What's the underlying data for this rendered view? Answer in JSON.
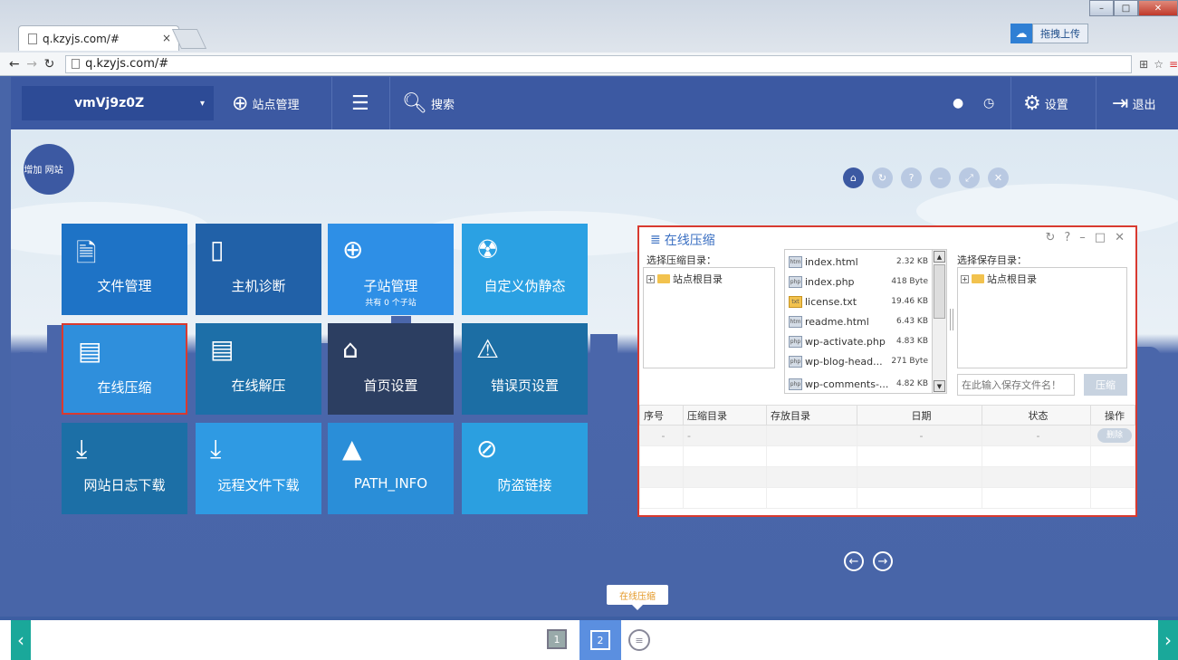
{
  "browser": {
    "tab_title": "q.kzyjs.com/#",
    "tab_close": "×",
    "url": "q.kzyjs.com/#",
    "upload_label": "拖拽上传"
  },
  "nav": {
    "site_name": "vmVj9z0Z",
    "site_caret": "▾",
    "site_manage": "站点管理",
    "search": "搜索",
    "settings": "设置",
    "logout": "退出"
  },
  "add_site": "增加 网站",
  "tiles": [
    {
      "label": "文件管理",
      "color": "#1e73c6"
    },
    {
      "label": "主机诊断",
      "color": "#2161a8"
    },
    {
      "label": "子站管理",
      "sub": "共有 0 个子站",
      "color": "#2e8fe6"
    },
    {
      "label": "自定义伪静态",
      "color": "#2ba1e3"
    },
    {
      "label": "在线压缩",
      "color": "#2f8fdc"
    },
    {
      "label": "在线解压",
      "color": "#1d6fa8"
    },
    {
      "label": "首页设置",
      "color": "#2c3e61"
    },
    {
      "label": "错误页设置",
      "color": "#1c6ea4"
    },
    {
      "label": "网站日志下载",
      "color": "#1c6fa6"
    },
    {
      "label": "远程文件下载",
      "color": "#2f9ae3"
    },
    {
      "label": "PATH_INFO",
      "color": "#2a8ed8"
    },
    {
      "label": "防盗链接",
      "color": "#2b9fe0"
    }
  ],
  "dialog": {
    "title": "在线压缩",
    "source_label": "选择压缩目录：",
    "dest_label": "选择保存目录：",
    "root_folder": "站点根目录",
    "files": [
      {
        "name": "index.html",
        "size": "2.32 KB"
      },
      {
        "name": "index.php",
        "size": "418 Byte"
      },
      {
        "name": "license.txt",
        "size": "19.46 KB"
      },
      {
        "name": "readme.html",
        "size": "6.43 KB"
      },
      {
        "name": "wp-activate.php",
        "size": "4.83 KB"
      },
      {
        "name": "wp-blog-head...",
        "size": "271 Byte"
      },
      {
        "name": "wp-comments-...",
        "size": "4.82 KB"
      }
    ],
    "save_placeholder": "在此输入保存文件名！",
    "compress_button": "压缩",
    "table_headers": [
      "序号",
      "压缩目录",
      "存放目录",
      "日期",
      "状态",
      "操作"
    ],
    "row": {
      "no": "-",
      "src": "-",
      "date": "-",
      "status": "-",
      "action": "删除"
    }
  },
  "tooltip": "在线压缩",
  "pages": {
    "p1": "1",
    "p2": "2"
  }
}
